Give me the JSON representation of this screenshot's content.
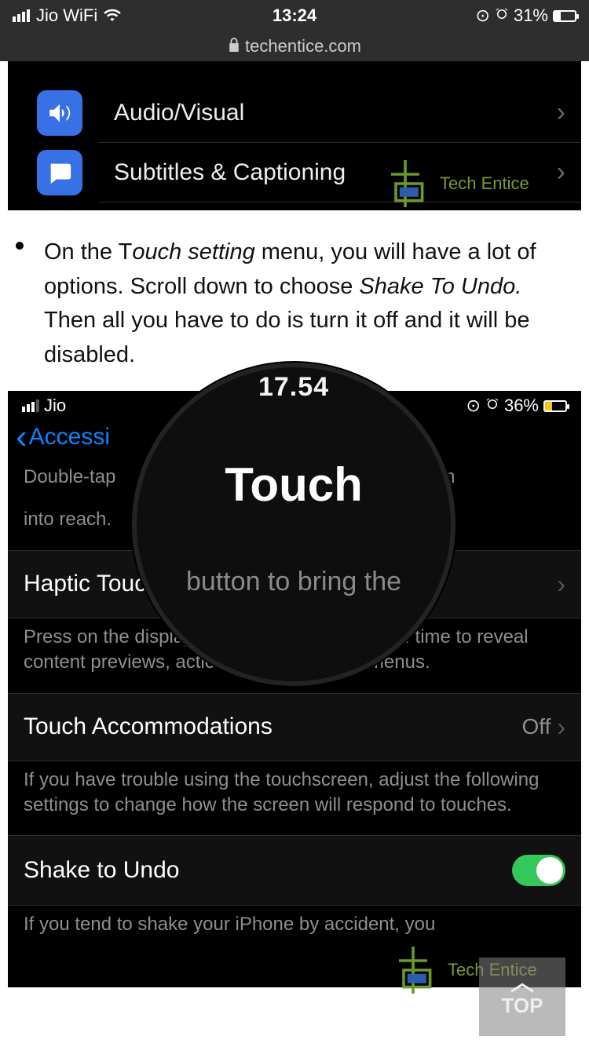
{
  "statusbar": {
    "carrier": "Jio WiFi",
    "time": "13:24",
    "battery_pct": "31%"
  },
  "urlbar": {
    "host": "techentice.com"
  },
  "shot1": {
    "items": [
      {
        "label": "Audio/Visual"
      },
      {
        "label": "Subtitles & Captioning"
      }
    ]
  },
  "article": {
    "pre": "On the T",
    "em1": "ouch setting",
    "mid": " menu, you will have a lot of options. Scroll down to choose ",
    "em2": "Shake To Undo.",
    "post": " Then all you have to do is turn it off and it will be disabled."
  },
  "shot2": {
    "sb": {
      "carrier": "Jio",
      "battery_pct": "36%"
    },
    "back": "Accessi",
    "reach_desc_a": "Double-tap ",
    "reach_desc_b": "e screen",
    "reach_desc_c": "into reach.",
    "haptic": {
      "label": "Haptic Touch",
      "desc": "Press on the display using a different length of time to reveal content previews, actions and contextual menus."
    },
    "accom": {
      "label": "Touch Accommodations",
      "value": "Off",
      "desc": "If you have trouble using the touchscreen, adjust the following settings to change how the screen will respond to touches."
    },
    "shake": {
      "label": "Shake to Undo",
      "desc": "If you tend to shake your iPhone by accident, you"
    }
  },
  "magnifier": {
    "time": "17.54",
    "title": "Touch",
    "sub": "button to bring the"
  },
  "watermark": "Tech Entice",
  "topbtn": "TOP"
}
